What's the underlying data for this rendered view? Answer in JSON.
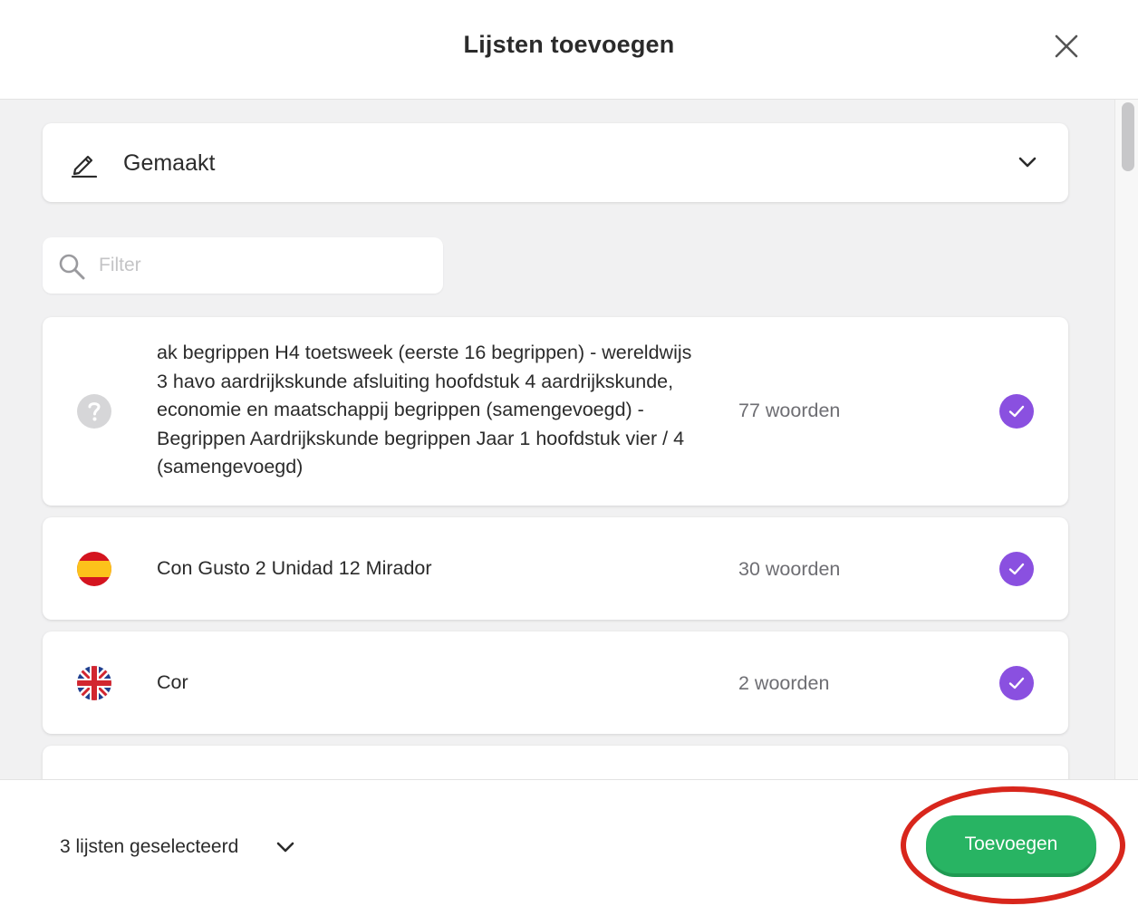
{
  "header": {
    "title": "Lijsten toevoegen",
    "close_icon": "close-icon"
  },
  "category": {
    "icon": "pencil-icon",
    "label": "Gemaakt",
    "chevron_icon": "chevron-down-icon"
  },
  "filter": {
    "icon": "search-icon",
    "placeholder": "Filter",
    "value": ""
  },
  "lists": [
    {
      "flag": "unknown-language-icon",
      "name": "ak begrippen H4 toetsweek (eerste 16 begrippen) - wereldwijs 3 havo aardrijkskunde afsluiting hoofdstuk 4 aardrijkskunde, economie en maatschappij begrippen (samengevoegd) - Begrippen Aardrijkskunde begrippen Jaar 1 hoofdstuk vier / 4 (samengevoegd)",
      "count": "77 woorden",
      "selected": true
    },
    {
      "flag": "spain-flag-icon",
      "name": "Con Gusto 2 Unidad 12 Mirador",
      "count": "30 woorden",
      "selected": true
    },
    {
      "flag": "uk-flag-icon",
      "name": "Cor",
      "count": "2 woorden",
      "selected": true
    }
  ],
  "footer": {
    "selected_label": "3 lijsten geselecteerd",
    "chevron_icon": "chevron-down-icon",
    "add_button": "Toevoegen"
  },
  "colors": {
    "accent_purple": "#8a50e0",
    "button_green": "#28b463",
    "highlight_red": "#d8261c"
  }
}
